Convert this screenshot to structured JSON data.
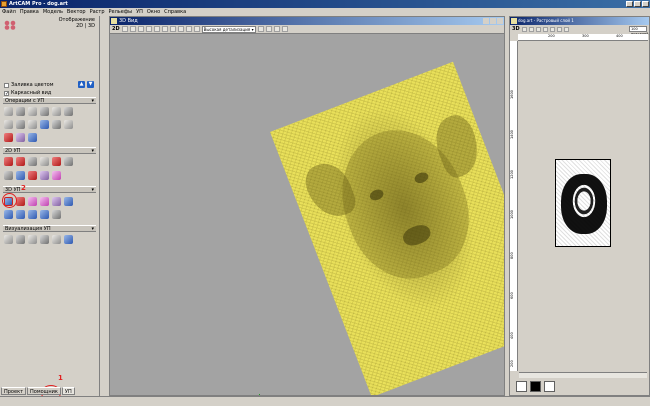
{
  "app": {
    "title": "ArtCAM Pro - dog.art"
  },
  "menu": [
    "Файл",
    "Правка",
    "Модель",
    "Вектор",
    "Растр",
    "Рельефы",
    "УП",
    "Окно",
    "Справка"
  ],
  "left_panel": {
    "view_label": "Отображение",
    "view_mode": "2D | 3D",
    "fill_color_label": "Заливка цветом",
    "wireframe_label": "Каркасный вид",
    "sections": [
      {
        "title": "Операции с УП"
      },
      {
        "title": "2D УП"
      },
      {
        "title": "3D УП"
      },
      {
        "title": "Визуализация УП"
      }
    ],
    "tabs": [
      "Проект",
      "Помощник",
      "УП"
    ],
    "annotations": {
      "mark_1": "1",
      "mark_2": "2"
    }
  },
  "view3d": {
    "title": "3D Вид",
    "toolbar_label": "2D",
    "detail_select": "Высокая детализация"
  },
  "raster_window": {
    "title": "dog.art - Растровый слой 1",
    "toolbar_label": "3D",
    "zoom_value": "100 пикселей",
    "ruler_top": [
      "200",
      "300",
      "400"
    ],
    "ruler_left": [
      "1600",
      "1400",
      "1200",
      "1000",
      "800",
      "600",
      "400",
      "200"
    ]
  },
  "colors": {
    "relief_yellow": "#e9e05a",
    "background_grey": "#a3a3a3",
    "annotation_red": "#e02020"
  }
}
